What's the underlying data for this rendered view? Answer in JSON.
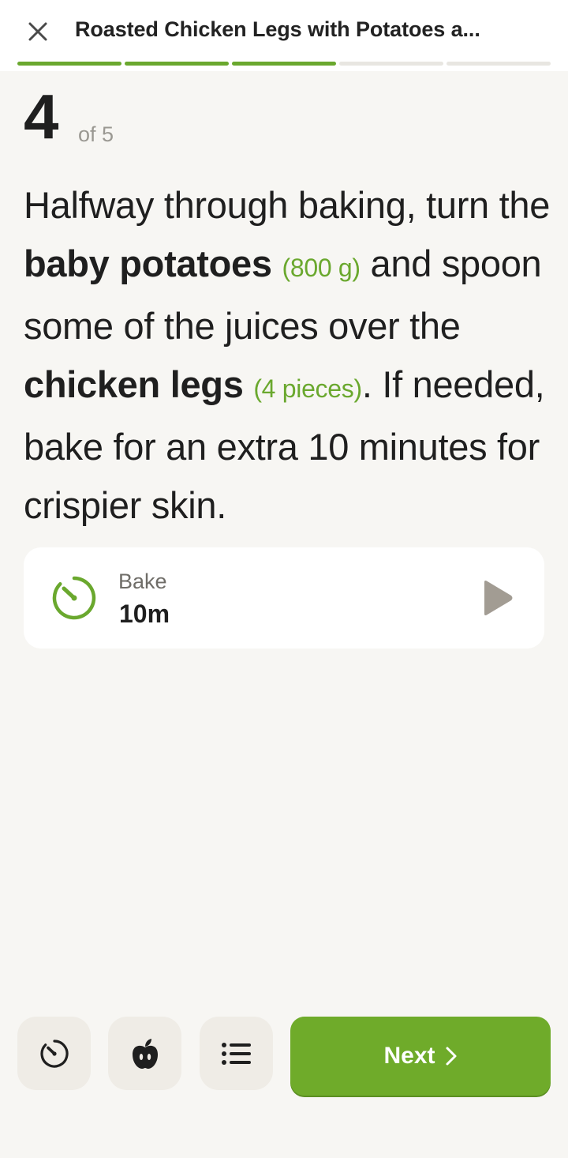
{
  "header": {
    "title": "Roasted Chicken Legs with Potatoes a...",
    "close_icon": "close-icon"
  },
  "progress": {
    "total_steps": 5,
    "completed": 3
  },
  "step": {
    "number": "4",
    "of_label": "of 5"
  },
  "instruction": {
    "part1": "Halfway through baking, turn the ",
    "ingredient1": "baby potatoes",
    "qty1": "(800 g)",
    "part2": " and spoon some of the juices over the ",
    "ingredient2": "chicken legs",
    "qty2": "(4 pieces)",
    "part3": ". If needed, bake for an extra 10 minutes for crispier skin."
  },
  "timer": {
    "label": "Bake",
    "value": "10m",
    "icon": "timer-icon",
    "play_icon": "play-icon"
  },
  "toolbar": {
    "timer_icon": "timer-icon",
    "ingredients_icon": "apple-icon",
    "steps_icon": "list-icon",
    "next_label": "Next",
    "next_icon": "chevron-right-icon"
  },
  "colors": {
    "accent": "#6fab2a",
    "background": "#f7f6f3",
    "card": "#ffffff",
    "text": "#1f1f1f",
    "muted": "#9a9892"
  }
}
